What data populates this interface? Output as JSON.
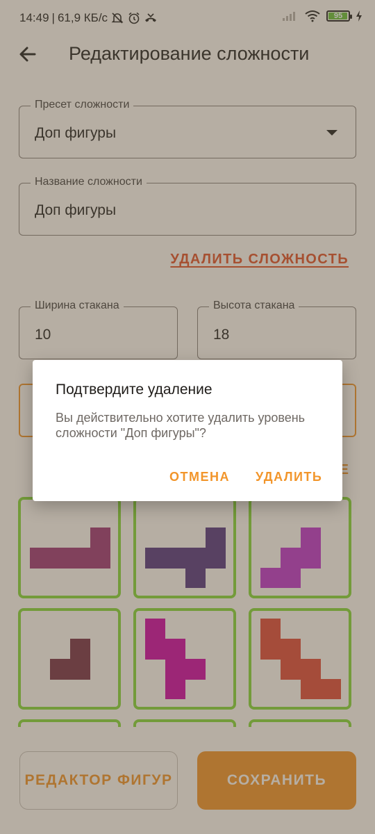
{
  "status": {
    "time": "14:49",
    "speed": "61,9 КБ/с",
    "battery": "95"
  },
  "header": {
    "title": "Редактирование сложности"
  },
  "preset": {
    "label": "Пресет сложности",
    "value": "Доп фигуры"
  },
  "name": {
    "label": "Название сложности",
    "value": "Доп фигуры"
  },
  "delete_difficulty_label": "УДАЛИТЬ СЛОЖНОСТЬ",
  "glass": {
    "width_label": "Ширина стакана",
    "width_value": "10",
    "height_label": "Высота стакана",
    "height_value": "18"
  },
  "partial_text": "E",
  "figures": [
    {
      "name": "figure-l-long",
      "color": "#a33c74"
    },
    {
      "name": "figure-t-shape",
      "color": "#5c3b7e"
    },
    {
      "name": "figure-s-shape",
      "color": "#c23ac6"
    },
    {
      "name": "figure-small-l",
      "color": "#7d3647"
    },
    {
      "name": "figure-zigzag-pink",
      "color": "#d10da0"
    },
    {
      "name": "figure-zigzag-red",
      "color": "#e14e3a"
    }
  ],
  "colors": {
    "accent": "#f2952a",
    "danger": "#e2552a",
    "tile_border": "#8bd63a"
  },
  "buttons": {
    "shape_editor": "РЕДАКТОР ФИГУР",
    "save": "СОХРАНИТЬ"
  },
  "dialog": {
    "title": "Подтвердите удаление",
    "message": "Вы действительно хотите удалить уровень сложности \"Доп фигуры\"?",
    "cancel": "ОТМЕНА",
    "confirm": "УДАЛИТЬ"
  }
}
